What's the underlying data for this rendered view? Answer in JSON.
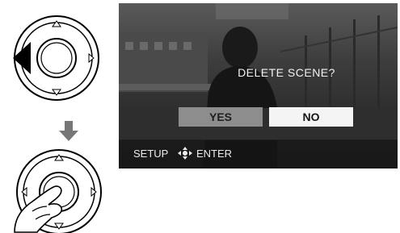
{
  "screen": {
    "prompt": "DELETE SCENE?",
    "options": [
      {
        "label": "YES",
        "selected": false
      },
      {
        "label": "NO",
        "selected": true
      }
    ],
    "footer": {
      "setup_label": "SETUP",
      "enter_label": "ENTER",
      "icon": "joystick-icon"
    }
  },
  "illustration": {
    "step1_icon": "joystick-press-left-icon",
    "arrow_icon": "down-arrow-icon",
    "step2_icon": "joystick-press-center-icon"
  },
  "colors": {
    "selected_option_bg": "#f4f4f4",
    "unselected_option_bg": "#8d8d8d",
    "arrow": "#777777"
  }
}
